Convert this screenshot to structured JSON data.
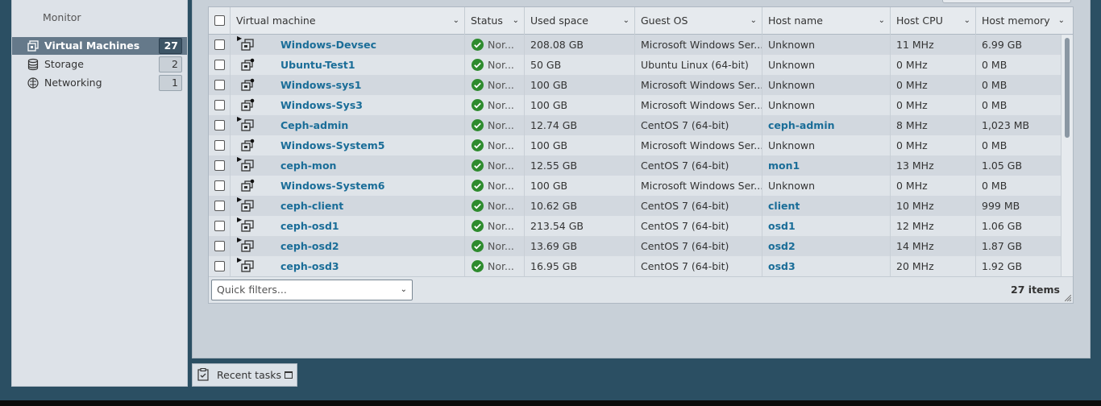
{
  "sidebar": {
    "monitor_label": "Monitor",
    "items": [
      {
        "label": "Virtual Machines",
        "count": "27",
        "icon": "vm-icon",
        "active": true
      },
      {
        "label": "Storage",
        "count": "2",
        "icon": "storage-icon",
        "active": false
      },
      {
        "label": "Networking",
        "count": "1",
        "icon": "network-icon",
        "active": false
      }
    ]
  },
  "grid": {
    "columns": {
      "vm": "Virtual machine",
      "status": "Status",
      "used": "Used space",
      "os": "Guest OS",
      "host": "Host name",
      "cpu": "Host CPU",
      "mem": "Host memory"
    },
    "rows": [
      {
        "name": "Windows-Devsec",
        "status": "Nor...",
        "used": "208.08 GB",
        "os": "Microsoft Windows Ser...",
        "host": "Unknown",
        "cpu": "11 MHz",
        "mem": "6.99 GB"
      },
      {
        "name": "Ubuntu-Test1",
        "status": "Nor...",
        "used": "50 GB",
        "os": "Ubuntu Linux (64-bit)",
        "host": "Unknown",
        "cpu": "0 MHz",
        "mem": "0 MB"
      },
      {
        "name": "Windows-sys1",
        "status": "Nor...",
        "used": "100 GB",
        "os": "Microsoft Windows Ser...",
        "host": "Unknown",
        "cpu": "0 MHz",
        "mem": "0 MB"
      },
      {
        "name": "Windows-Sys3",
        "status": "Nor...",
        "used": "100 GB",
        "os": "Microsoft Windows Ser...",
        "host": "Unknown",
        "cpu": "0 MHz",
        "mem": "0 MB"
      },
      {
        "name": "Ceph-admin",
        "status": "Nor...",
        "used": "12.74 GB",
        "os": "CentOS 7 (64-bit)",
        "host": "ceph-admin",
        "cpu": "8 MHz",
        "mem": "1,023 MB"
      },
      {
        "name": "Windows-System5",
        "status": "Nor...",
        "used": "100 GB",
        "os": "Microsoft Windows Ser...",
        "host": "Unknown",
        "cpu": "0 MHz",
        "mem": "0 MB"
      },
      {
        "name": "ceph-mon",
        "status": "Nor...",
        "used": "12.55 GB",
        "os": "CentOS 7 (64-bit)",
        "host": "mon1",
        "cpu": "13 MHz",
        "mem": "1.05 GB"
      },
      {
        "name": "Windows-System6",
        "status": "Nor...",
        "used": "100 GB",
        "os": "Microsoft Windows Ser...",
        "host": "Unknown",
        "cpu": "0 MHz",
        "mem": "0 MB"
      },
      {
        "name": "ceph-client",
        "status": "Nor...",
        "used": "10.62 GB",
        "os": "CentOS 7 (64-bit)",
        "host": "client",
        "cpu": "10 MHz",
        "mem": "999 MB"
      },
      {
        "name": "ceph-osd1",
        "status": "Nor...",
        "used": "213.54 GB",
        "os": "CentOS 7 (64-bit)",
        "host": "osd1",
        "cpu": "12 MHz",
        "mem": "1.06 GB"
      },
      {
        "name": "ceph-osd2",
        "status": "Nor...",
        "used": "13.69 GB",
        "os": "CentOS 7 (64-bit)",
        "host": "osd2",
        "cpu": "14 MHz",
        "mem": "1.87 GB"
      },
      {
        "name": "ceph-osd3",
        "status": "Nor...",
        "used": "16.95 GB",
        "os": "CentOS 7 (64-bit)",
        "host": "osd3",
        "cpu": "20 MHz",
        "mem": "1.92 GB"
      }
    ],
    "quick_filters_placeholder": "Quick filters...",
    "items_count": "27 items"
  },
  "recent_tasks_label": "Recent tasks",
  "colors": {
    "accent": "#1a6d98",
    "ok": "#2e8b2e",
    "sidebar_active": "#65798a"
  }
}
